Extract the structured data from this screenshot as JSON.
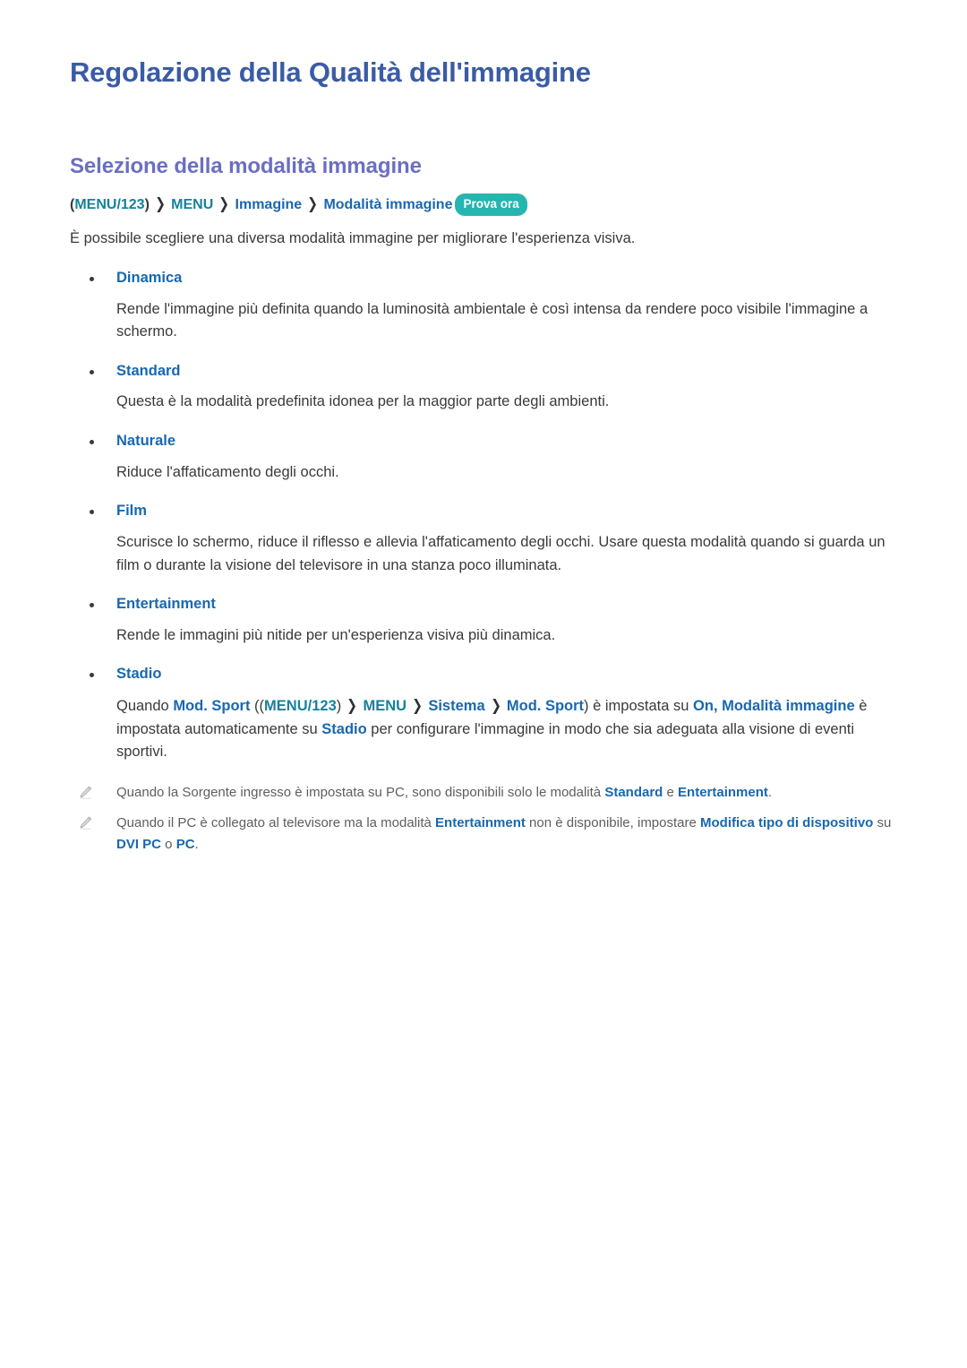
{
  "document": {
    "title": "Regolazione della Qualità dell'immagine",
    "section_title": "Selezione della modalità immagine"
  },
  "breadcrumb": {
    "open_paren": "(",
    "menu123": "MENU/123",
    "close_paren": ")",
    "separator": "❯",
    "menu": "MENU",
    "immagine": "Immagine",
    "modalita_immagine": "Modalità immagine",
    "badge": "Prova ora"
  },
  "intro": "È possibile scegliere una diversa modalità immagine per migliorare l'esperienza visiva.",
  "modes": [
    {
      "label": "Dinamica",
      "description": "Rende l'immagine più definita quando la luminosità ambientale è così intensa da rendere poco visibile l'immagine a schermo."
    },
    {
      "label": "Standard",
      "description": "Questa è la modalità predefinita idonea per la maggior parte degli ambienti."
    },
    {
      "label": "Naturale",
      "description": "Riduce l'affaticamento degli occhi."
    },
    {
      "label": "Film",
      "description": "Scurisce lo schermo, riduce il riflesso e allevia l'affaticamento degli occhi. Usare questa modalità quando si guarda un film o durante la visione del televisore in una stanza poco illuminata."
    },
    {
      "label": "Entertainment",
      "description": "Rende le immagini più nitide per un'esperienza visiva più dinamica."
    },
    {
      "label": "Stadio",
      "description_parts": {
        "t1": "Quando ",
        "mod_sport_1": "Mod. Sport",
        "t2": " ((",
        "menu123": "MENU/123",
        "sep1": "❯",
        "menu": "MENU",
        "sep2": "❯",
        "sistema": "Sistema",
        "sep3": "❯",
        "mod_sport_2": "Mod. Sport",
        "t3": ") è impostata su ",
        "on_modalita": "On, Modalità immagine",
        "t4": " è impostata automaticamente su ",
        "stadio": "Stadio",
        "t5": " per configurare l'immagine in modo che sia adeguata alla visione di eventi sportivi."
      }
    }
  ],
  "notes": [
    {
      "icon": "pencil-icon",
      "parts": {
        "t1": "Quando la Sorgente ingresso è impostata su PC, sono disponibili solo le modalità ",
        "standard": "Standard",
        "t2": " e ",
        "entertainment": "Entertainment",
        "t3": "."
      }
    },
    {
      "icon": "pencil-icon",
      "parts": {
        "t1": "Quando il PC è collegato al televisore ma la modalità ",
        "entertainment": "Entertainment",
        "t2": " non è disponibile, impostare ",
        "modifica": "Modifica tipo di dispositivo",
        "t3": " su ",
        "dvipc": "DVI PC",
        "t4": " o ",
        "pc": "PC",
        "t5": "."
      }
    }
  ],
  "colors": {
    "title": "#3b5ba5",
    "section_title": "#6a6fc2",
    "blue": "#1868b0",
    "teal": "#16829b",
    "badge_bg": "#25b6b0",
    "body": "#3a3a3a",
    "note": "#5e5e5e"
  }
}
